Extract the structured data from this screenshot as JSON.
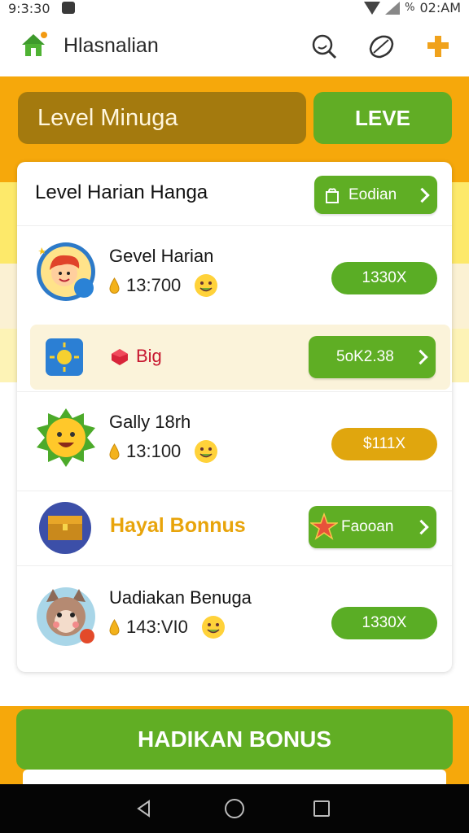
{
  "status_bar": {
    "time": "9:3:30",
    "right_time": "02:AM",
    "battery_text": "%"
  },
  "app_bar": {
    "title": "Hlasnalian",
    "icons": [
      "home-icon",
      "search-icon",
      "tag-icon",
      "puzzle-icon"
    ]
  },
  "level_bar": {
    "label": "Level Minuga",
    "button_label": "LEVE"
  },
  "card": {
    "title": "Level Harian Hanga",
    "header_button": "Eodian",
    "rows": [
      {
        "name": "Gevel Harian",
        "amount": "13:700",
        "button": "1330X",
        "button_color": "green"
      },
      {
        "name": "Big",
        "button": "5oK2.38",
        "highlight": true
      },
      {
        "name": "Gally 18rh",
        "amount": "13:100",
        "button": "$111X",
        "button_color": "gold"
      },
      {
        "name": "Hayal Bonnus",
        "button": "Faooan",
        "highlight": true
      },
      {
        "name": "Uadiakan Benuga",
        "amount": "143:VI0",
        "button": "1330X",
        "button_color": "green"
      }
    ]
  },
  "cta": {
    "label": "HADIKAN BONUS"
  },
  "colors": {
    "orange": "#f6a80b",
    "green": "#5fae24",
    "gold": "#e0a60e",
    "brown": "#a47a0e",
    "bonus_text": "#e8a40b"
  },
  "nav": {
    "icons": [
      "back-icon",
      "home-nav-icon",
      "recent-apps-icon"
    ]
  }
}
